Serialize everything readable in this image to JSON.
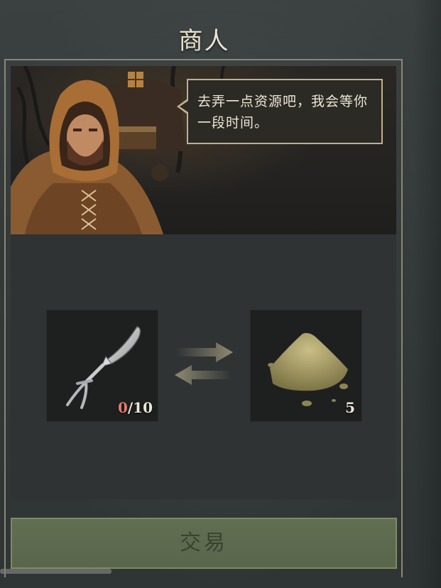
{
  "title": "商人",
  "merchant": {
    "dialogue": "去弄一点资源吧，我会等你一段时间。"
  },
  "trade": {
    "give": {
      "icon": "bone-fork-icon",
      "have": "0",
      "need": "/10"
    },
    "receive": {
      "icon": "sand-pile-icon",
      "amount": "5"
    },
    "exchange_icon": "exchange-arrows-icon"
  },
  "button": {
    "trade_label": "交易"
  },
  "colors": {
    "button_bg": "#5f6b4f",
    "button_text": "#39432f",
    "count_deficit": "#e07a70",
    "bubble_border": "#bfb28a"
  }
}
